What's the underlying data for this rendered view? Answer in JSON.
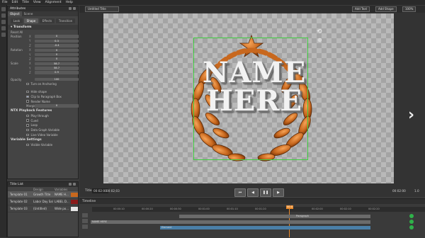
{
  "menu": [
    "File",
    "Edit",
    "Title",
    "View",
    "Alignment",
    "Help"
  ],
  "attributes": {
    "title": "Attributes",
    "tabs": [
      "Object",
      "Scene"
    ],
    "subtabs": [
      "Look",
      "Shape",
      "Effects",
      "Transition"
    ],
    "section_transform": "Transform",
    "reset_all": "Reset All",
    "position_label": "Position",
    "rotation_label": "Rotation",
    "scale_label": "Scale",
    "rows": [
      {
        "label": "Position",
        "axis": "X",
        "value": "0"
      },
      {
        "label": "",
        "axis": "Y",
        "value": "0.3"
      },
      {
        "label": "",
        "axis": "Z",
        "value": "-0.4"
      },
      {
        "label": "Rotation",
        "axis": "X",
        "value": "0"
      },
      {
        "label": "",
        "axis": "Y",
        "value": "0"
      },
      {
        "label": "",
        "axis": "Z",
        "value": "0"
      },
      {
        "label": "Scale",
        "axis": "X",
        "value": "58.7"
      },
      {
        "label": "",
        "axis": "Y",
        "value": "58.7"
      },
      {
        "label": "",
        "axis": "Z",
        "value": "0.9"
      }
    ],
    "opacity_label": "Opacity",
    "opacity_value": "100",
    "checks_top": [
      {
        "label": "Turn on Anchoring",
        "on": false
      }
    ],
    "checks_mid": [
      {
        "label": "Hide shape",
        "on": false
      },
      {
        "label": "Clip to Paragraph Box",
        "on": true
      },
      {
        "label": "Render Name",
        "on": false
      }
    ],
    "margin_label": "Margin",
    "margin_value": "0",
    "ntx_title": "NTX Playback Features",
    "ntx_checks": [
      {
        "label": "Play through",
        "on": false
      },
      {
        "label": "Cued",
        "on": false
      },
      {
        "label": "Loop",
        "on": false
      },
      {
        "label": "Data Graph Variable",
        "on": false
      },
      {
        "label": "Live Video Variable",
        "on": false
      }
    ],
    "var_title": "Variable Settings",
    "var_checks": [
      {
        "label": "Visible Variable",
        "on": false
      }
    ]
  },
  "titlelist": {
    "title": "Title List",
    "columns": [
      "",
      "Design",
      "Variables"
    ],
    "rows": [
      {
        "name": "Template 01",
        "design": "Growth Title",
        "var": "NAME H...",
        "color": "#c8681e"
      },
      {
        "name": "Template 02",
        "design": "Labor Day Sal",
        "var": "LABEL D...",
        "color": "#8a1a1a"
      },
      {
        "name": "Template 03",
        "design": "(Untitled)",
        "var": "Wide po...",
        "color": "#e6e6e6"
      }
    ]
  },
  "viewer": {
    "title_dropdown": "Untitled Title",
    "add_text": "Add Text",
    "add_shape": "Add Shape",
    "zoom": "100%",
    "name_line1": "NAME",
    "name_line2": "HERE",
    "title_label": "Title",
    "timecode_left": "00:02:00",
    "timecode_left2": "00:02;03",
    "timecode_right": "00:02:00",
    "speed": "1.0"
  },
  "timeline": {
    "title": "Timeline",
    "playhead": "00:0",
    "track1": "Paragraph",
    "track2": "NAME HERE",
    "track3": "Element",
    "ticks": [
      "00:00:00",
      "00:00:10",
      "00:00:20",
      "00:00:30",
      "00:01:00",
      "00:01:10",
      "00:01:20",
      "00:01:30",
      "00:02:00",
      "00:02:10",
      "00:02:20",
      "00:02:30",
      "00:03:00"
    ]
  },
  "colors": {
    "selection": "#3fcf3f",
    "wreath": "#c8681e",
    "accent": "#e8892a"
  }
}
